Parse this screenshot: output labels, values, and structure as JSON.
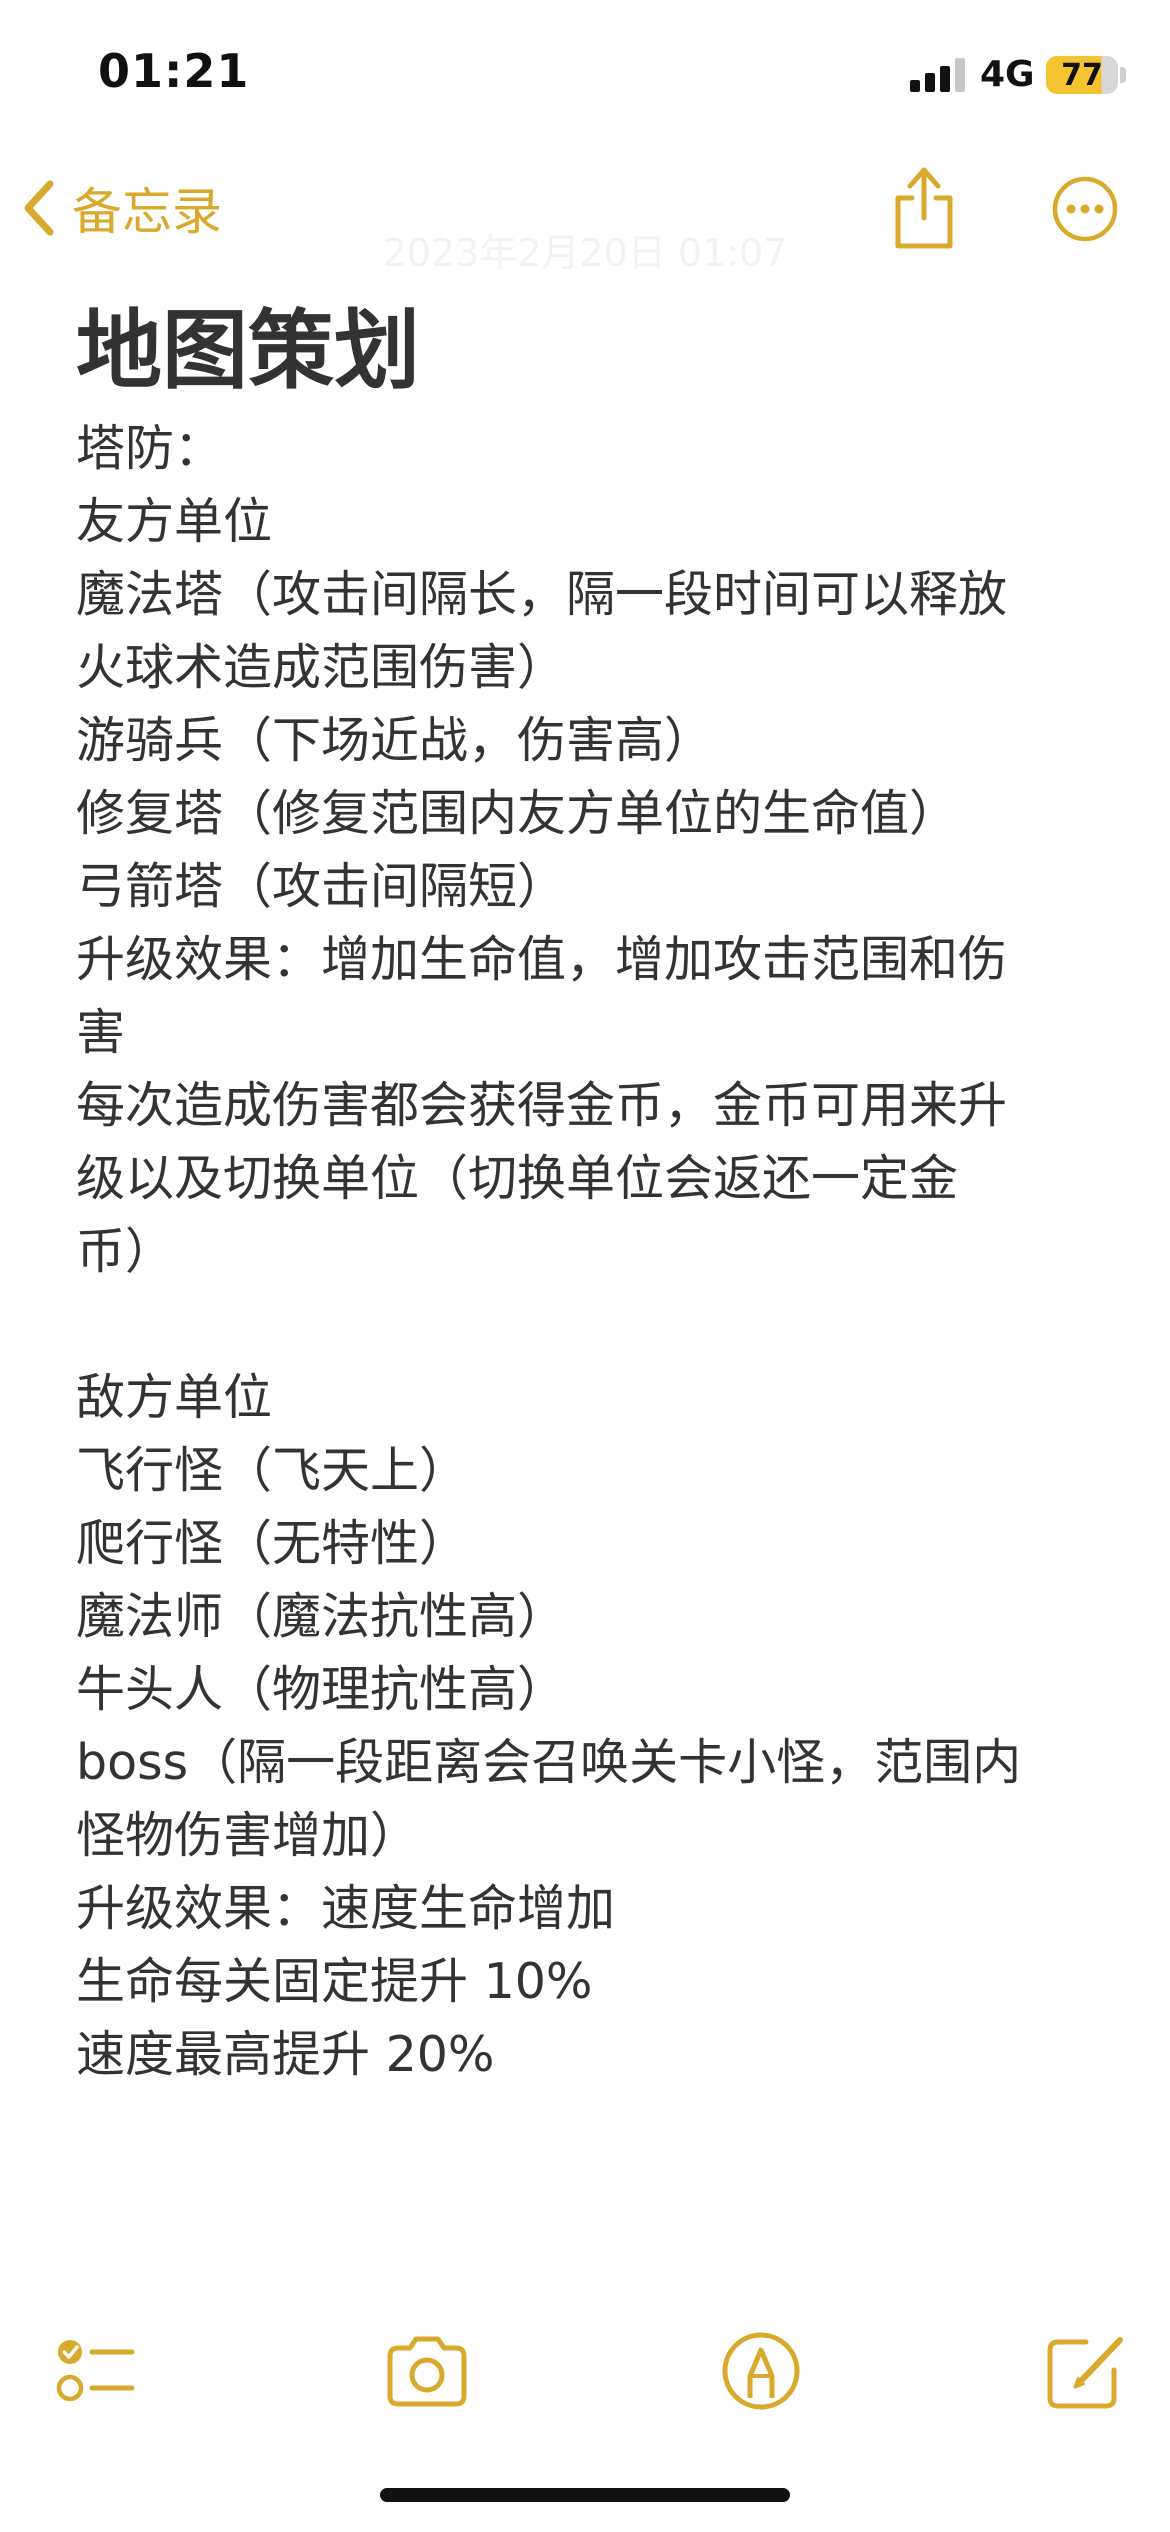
{
  "status_bar": {
    "time": "01:21",
    "network": "4G",
    "battery": "77"
  },
  "nav": {
    "back_label": "备忘录",
    "date": "2023年2月20日 01:07"
  },
  "note": {
    "title": "地图策划",
    "lines": [
      "塔防：",
      "友方单位",
      "魔法塔（攻击间隔长，隔一段时间可以释放",
      "火球术造成范围伤害）",
      "游骑兵（下场近战，伤害高）",
      "修复塔（修复范围内友方单位的生命值）",
      "弓箭塔（攻击间隔短）",
      "升级效果：增加生命值，增加攻击范围和伤",
      "害",
      "每次造成伤害都会获得金币，金币可用来升",
      "级以及切换单位（切换单位会返还一定金",
      "币）",
      "",
      "敌方单位",
      "飞行怪（飞天上）",
      "爬行怪（无特性）",
      "魔法师（魔法抗性高）",
      "牛头人（物理抗性高）",
      "boss（隔一段距离会召唤关卡小怪，范围内",
      "怪物伤害增加）",
      "升级效果：速度生命增加",
      "生命每关固定提升 10%",
      "速度最高提升 20%"
    ]
  },
  "toolbar": {
    "icons": [
      "checklist-icon",
      "camera-icon",
      "markup-icon",
      "compose-icon"
    ]
  },
  "colors": {
    "accent": "#d9a92b",
    "text": "#333333",
    "battery": "#f4c430"
  }
}
